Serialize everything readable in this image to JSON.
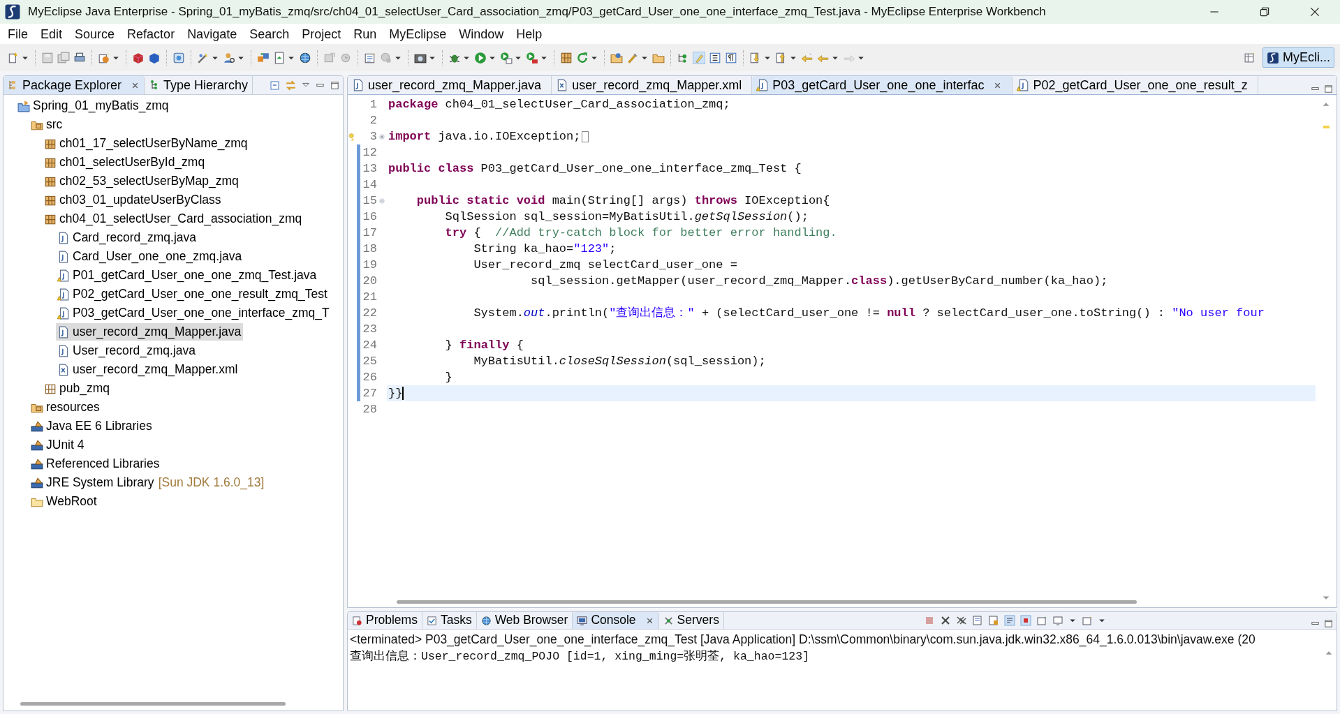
{
  "window": {
    "title": "MyEclipse Java Enterprise - Spring_01_myBatis_zmq/src/ch04_01_selectUser_Card_association_zmq/P03_getCard_User_one_one_interface_zmq_Test.java - MyEclipse Enterprise Workbench"
  },
  "menu": [
    "File",
    "Edit",
    "Source",
    "Refactor",
    "Navigate",
    "Search",
    "Project",
    "Run",
    "MyEclipse",
    "Window",
    "Help"
  ],
  "perspective": {
    "label": "MyEcli..."
  },
  "package_explorer": {
    "tabs": [
      {
        "label": "Package Explorer",
        "selected": true,
        "closable": true
      },
      {
        "label": "Type Hierarchy",
        "selected": false,
        "closable": false
      }
    ],
    "tree": [
      {
        "label": "Spring_01_myBatis_zmq",
        "kind": "project",
        "selected": false,
        "children": [
          {
            "label": "src",
            "kind": "source-folder",
            "selected": false,
            "children": [
              {
                "label": "ch01_17_selectUserByName_zmq",
                "kind": "package",
                "selected": false
              },
              {
                "label": "ch01_selectUserById_zmq",
                "kind": "package",
                "selected": false
              },
              {
                "label": "ch02_53_selectUserByMap_zmq",
                "kind": "package",
                "selected": false
              },
              {
                "label": "ch03_01_updateUserByClass",
                "kind": "package",
                "selected": false
              },
              {
                "label": "ch04_01_selectUser_Card_association_zmq",
                "kind": "package",
                "selected": false,
                "children": [
                  {
                    "label": "Card_record_zmq.java",
                    "kind": "java",
                    "selected": false
                  },
                  {
                    "label": "Card_User_one_one_zmq.java",
                    "kind": "java",
                    "selected": false
                  },
                  {
                    "label": "P01_getCard_User_one_one_zmq_Test.java",
                    "kind": "java-warning",
                    "selected": false
                  },
                  {
                    "label": "P02_getCard_User_one_one_result_zmq_Test",
                    "kind": "java-warning",
                    "selected": false
                  },
                  {
                    "label": "P03_getCard_User_one_one_interface_zmq_T",
                    "kind": "java-warning",
                    "selected": false
                  },
                  {
                    "label": "user_record_zmq_Mapper.java",
                    "kind": "java",
                    "selected": true
                  },
                  {
                    "label": "User_record_zmq.java",
                    "kind": "java",
                    "selected": false
                  },
                  {
                    "label": "user_record_zmq_Mapper.xml",
                    "kind": "xml",
                    "selected": false
                  }
                ]
              },
              {
                "label": "pub_zmq",
                "kind": "empty-package",
                "selected": false
              }
            ]
          },
          {
            "label": "resources",
            "kind": "source-folder",
            "selected": false
          },
          {
            "label": "Java EE 6 Libraries",
            "kind": "library",
            "selected": false
          },
          {
            "label": "JUnit 4",
            "kind": "library",
            "selected": false
          },
          {
            "label": "Referenced Libraries",
            "kind": "library",
            "selected": false
          },
          {
            "label": "JRE System Library",
            "decoration": "[Sun JDK 1.6.0_13]",
            "kind": "library",
            "selected": false
          },
          {
            "label": "WebRoot",
            "kind": "folder",
            "selected": false
          }
        ]
      }
    ]
  },
  "editor": {
    "tabs": [
      {
        "label": "user_record_zmq_Mapper.java",
        "kind": "java",
        "selected": false,
        "closable": false
      },
      {
        "label": "user_record_zmq_Mapper.xml",
        "kind": "xml",
        "selected": false,
        "closable": false
      },
      {
        "label": "P03_getCard_User_one_one_interfac",
        "kind": "java-warning",
        "selected": true,
        "closable": true
      },
      {
        "label": "P02_getCard_User_one_one_result_z",
        "kind": "java-warning",
        "selected": false,
        "closable": false
      }
    ],
    "lines": [
      {
        "number": "1",
        "current": false,
        "changed": false,
        "segments": [
          {
            "kind": "keyword",
            "text": "package"
          },
          {
            "kind": "plain",
            "text": " ch04_01_selectUser_Card_association_zmq;"
          }
        ]
      },
      {
        "number": "2",
        "current": false,
        "changed": false
      },
      {
        "number": "3",
        "current": false,
        "changed": false,
        "expanded": false,
        "warning": true,
        "segments": [
          {
            "kind": "keyword",
            "text": "import"
          },
          {
            "kind": "plain",
            "text": " java.io.IOException;"
          }
        ]
      },
      {
        "number": "12",
        "current": false,
        "changed": true
      },
      {
        "number": "13",
        "current": false,
        "changed": true,
        "segments": [
          {
            "kind": "keyword",
            "text": "public class"
          },
          {
            "kind": "plain",
            "text": " P03_getCard_User_one_one_interface_zmq_Test {"
          }
        ]
      },
      {
        "number": "14",
        "current": false,
        "changed": true
      },
      {
        "number": "15",
        "current": false,
        "changed": true,
        "expanded": true,
        "segments": [
          {
            "kind": "keyword",
            "text": "    public static void"
          },
          {
            "kind": "plain",
            "text": " main(String[] args) "
          },
          {
            "kind": "keyword",
            "text": "throws"
          },
          {
            "kind": "plain",
            "text": " IOException{"
          }
        ]
      },
      {
        "number": "16",
        "current": false,
        "changed": true,
        "segments": [
          {
            "kind": "plain",
            "text": "        SqlSession sql_session=MyBatisUtil."
          },
          {
            "kind": "static",
            "text": "getSqlSession"
          },
          {
            "kind": "plain",
            "text": "();"
          }
        ]
      },
      {
        "number": "17",
        "current": false,
        "changed": true,
        "segments": [
          {
            "kind": "keyword",
            "text": "        try"
          },
          {
            "kind": "plain",
            "text": " {  "
          },
          {
            "kind": "comment",
            "text": "//Add try-catch block for better error handling."
          }
        ]
      },
      {
        "number": "18",
        "current": false,
        "changed": true,
        "segments": [
          {
            "kind": "plain",
            "text": "            String ka_hao="
          },
          {
            "kind": "string",
            "text": "\"123\""
          },
          {
            "kind": "plain",
            "text": ";"
          }
        ]
      },
      {
        "number": "19",
        "current": false,
        "changed": true,
        "segments": [
          {
            "kind": "plain",
            "text": "            User_record_zmq selectCard_user_one ="
          }
        ]
      },
      {
        "number": "20",
        "current": false,
        "changed": true,
        "segments": [
          {
            "kind": "plain",
            "text": "                    sql_session.getMapper(user_record_zmq_Mapper."
          },
          {
            "kind": "keyword",
            "text": "class"
          },
          {
            "kind": "plain",
            "text": ").getUserByCard_number(ka_hao);"
          }
        ]
      },
      {
        "number": "21",
        "current": false,
        "changed": true
      },
      {
        "number": "22",
        "current": false,
        "changed": true,
        "segments": [
          {
            "kind": "plain",
            "text": "            System."
          },
          {
            "kind": "field",
            "text": "out"
          },
          {
            "kind": "plain",
            "text": ".println("
          },
          {
            "kind": "string",
            "text": "\"查询出信息：\""
          },
          {
            "kind": "plain",
            "text": " + (selectCard_user_one != "
          },
          {
            "kind": "keyword",
            "text": "null"
          },
          {
            "kind": "plain",
            "text": " ? selectCard_user_one.toString() : "
          },
          {
            "kind": "string",
            "text": "\"No user four"
          }
        ]
      },
      {
        "number": "23",
        "current": false,
        "changed": true
      },
      {
        "number": "24",
        "current": false,
        "changed": true,
        "segments": [
          {
            "kind": "plain",
            "text": "        } "
          },
          {
            "kind": "keyword",
            "text": "finally"
          },
          {
            "kind": "plain",
            "text": " {"
          }
        ]
      },
      {
        "number": "25",
        "current": false,
        "changed": true,
        "segments": [
          {
            "kind": "plain",
            "text": "            MyBatisUtil."
          },
          {
            "kind": "static",
            "text": "closeSqlSession"
          },
          {
            "kind": "plain",
            "text": "(sql_session);"
          }
        ]
      },
      {
        "number": "26",
        "current": false,
        "changed": true,
        "segments": [
          {
            "kind": "plain",
            "text": "        }"
          }
        ]
      },
      {
        "number": "27",
        "current": true,
        "changed": true,
        "segments": [
          {
            "kind": "plain",
            "text": "}}"
          }
        ]
      },
      {
        "number": "28",
        "current": false,
        "changed": false
      }
    ]
  },
  "console_panel": {
    "tabs": [
      {
        "label": "Problems",
        "selected": false,
        "closable": false
      },
      {
        "label": "Tasks",
        "selected": false,
        "closable": false
      },
      {
        "label": "Web Browser",
        "selected": false,
        "closable": false
      },
      {
        "label": "Console",
        "selected": true,
        "closable": true
      },
      {
        "label": "Servers",
        "selected": false,
        "closable": false
      }
    ],
    "header": "<terminated> P03_getCard_User_one_one_interface_zmq_Test [Java Application] D:\\ssm\\Common\\binary\\com.sun.java.jdk.win32.x86_64_1.6.0.013\\bin\\javaw.exe (20",
    "output": [
      "查询出信息：User_record_zmq_POJO [id=1, xing_ming=张明荃, ka_hao=123]"
    ]
  }
}
